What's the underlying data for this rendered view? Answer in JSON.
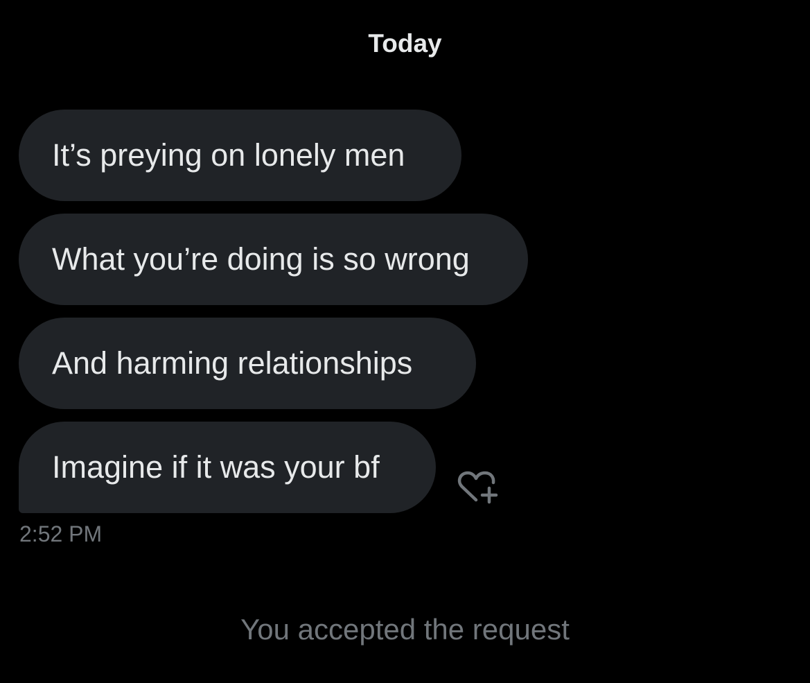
{
  "conversation": {
    "date_divider": "Today",
    "messages": [
      {
        "text": "It’s preying on lonely men"
      },
      {
        "text": "What you’re doing is so wrong"
      },
      {
        "text": "And harming relationships"
      },
      {
        "text": "Imagine if it was your bf"
      }
    ],
    "timestamp": "2:52 PM",
    "react_icon": "heart-plus-icon",
    "system_notice": "You accepted the request"
  },
  "colors": {
    "background": "#000000",
    "bubble": "#202327",
    "primary_text": "#e7e9ea",
    "secondary_text": "#71767b"
  }
}
